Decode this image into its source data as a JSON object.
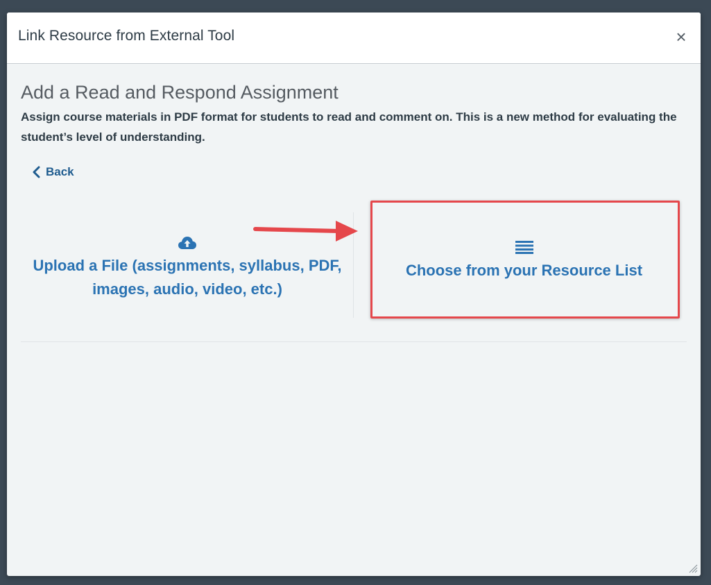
{
  "dialog": {
    "title": "Link Resource from External Tool",
    "close_label": "×"
  },
  "content": {
    "heading": "Add a Read and Respond Assignment",
    "description": "Assign course materials in PDF format for students to read and comment on. This is a new method for evaluating the student’s level of understanding.",
    "back_label": "Back"
  },
  "options": {
    "upload": {
      "icon": "cloud-upload-icon",
      "label_line1": "Upload a File (assignments, syllabus, PDF,",
      "label_line2": "images, audio, video, etc.)"
    },
    "resource_list": {
      "icon": "list-icon",
      "label": "Choose from your Resource List"
    }
  },
  "annotation": {
    "highlight_color": "#e5474b",
    "arrow_color": "#e5474b"
  },
  "colors": {
    "accent": "#2b73b3",
    "link": "#1f5c8f",
    "text": "#2d3b45",
    "backdrop": "#3c4955"
  }
}
